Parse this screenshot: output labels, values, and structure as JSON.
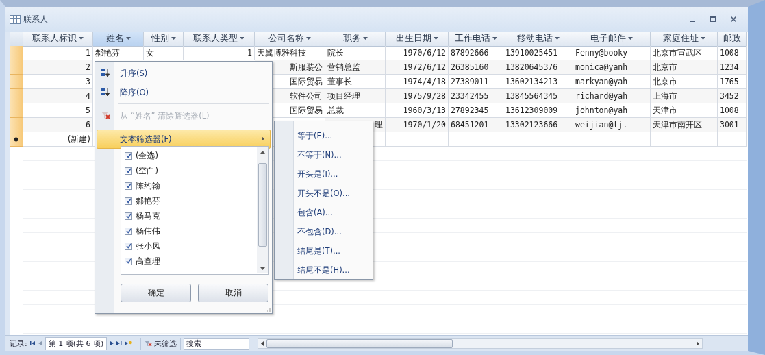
{
  "window": {
    "title": "联系人"
  },
  "table": {
    "columns": [
      {
        "label": "联系人标识",
        "kind": "number",
        "selected": false,
        "dropdown": true
      },
      {
        "label": "姓名",
        "kind": "text",
        "selected": true,
        "dropdown": true
      },
      {
        "label": "性别",
        "kind": "text",
        "selected": false,
        "dropdown": true
      },
      {
        "label": "联系人类型",
        "kind": "number",
        "selected": false,
        "dropdown": true
      },
      {
        "label": "公司名称",
        "kind": "text",
        "selected": false,
        "dropdown": true
      },
      {
        "label": "职务",
        "kind": "text",
        "selected": false,
        "dropdown": true
      },
      {
        "label": "出生日期",
        "kind": "number",
        "selected": false,
        "dropdown": true
      },
      {
        "label": "工作电话",
        "kind": "text",
        "selected": false,
        "dropdown": true
      },
      {
        "label": "移动电话",
        "kind": "text",
        "selected": false,
        "dropdown": true
      },
      {
        "label": "电子邮件",
        "kind": "text",
        "selected": false,
        "dropdown": true
      },
      {
        "label": "家庭住址",
        "kind": "text",
        "selected": false,
        "dropdown": true
      },
      {
        "label": "邮政",
        "kind": "text",
        "selected": false,
        "dropdown": false
      }
    ],
    "rows": [
      [
        "1",
        "郝艳芬",
        "女",
        "1",
        "天翼博雅科技",
        "院长",
        "1970/6/12",
        "87892666",
        "13910025451",
        "Fenny@booky",
        "北京市宣武区",
        "1008"
      ],
      [
        "2",
        null,
        null,
        null,
        "斯服装公",
        "营销总监",
        "1972/6/12",
        "26385160",
        "13820645376",
        "monica@yanh",
        "北京市",
        "1234"
      ],
      [
        "3",
        null,
        null,
        null,
        "国际贸易",
        "董事长",
        "1974/4/18",
        "27389011",
        "13602134213",
        "markyan@yah",
        "北京市",
        "1765"
      ],
      [
        "4",
        null,
        null,
        null,
        "软件公司",
        "项目经理",
        "1975/9/28",
        "23342455",
        "13845564345",
        "richard@yah",
        "上海市",
        "3452"
      ],
      [
        "5",
        null,
        null,
        null,
        "国际贸易",
        "总裁",
        "1960/3/13",
        "27892345",
        "13612309009",
        "johnton@yah",
        "天津市",
        "1008"
      ],
      [
        "6",
        null,
        null,
        null,
        null,
        "理",
        "1970/1/20",
        "68451201",
        "13302123666",
        "weijian@tj.",
        "天津市南开区",
        "3001"
      ]
    ],
    "new_row": {
      "label": "(新建)"
    }
  },
  "filter_menu": {
    "items": [
      {
        "kind": "sort-asc",
        "label": "升序(S)",
        "disabled": false,
        "selected": false
      },
      {
        "kind": "sort-desc",
        "label": "降序(O)",
        "disabled": false,
        "selected": false
      },
      {
        "kind": "clear",
        "label": "从 “姓名” 清除筛选器(L)",
        "disabled": true,
        "selected": false
      },
      {
        "kind": "submenu",
        "label": "文本筛选器(F)",
        "disabled": false,
        "selected": true
      }
    ],
    "values": [
      {
        "label": "(全选)",
        "checked": true
      },
      {
        "label": "(空白)",
        "checked": true
      },
      {
        "label": "陈约翰",
        "checked": true
      },
      {
        "label": "郝艳芬",
        "checked": true
      },
      {
        "label": "杨马克",
        "checked": true
      },
      {
        "label": "杨伟伟",
        "checked": true
      },
      {
        "label": "张小凤",
        "checked": true
      },
      {
        "label": "高查理",
        "checked": true
      }
    ],
    "buttons": [
      "确定",
      "取消"
    ],
    "submenu": [
      "等于(E)...",
      "不等于(N)...",
      "开头是(I)...",
      "开头不是(O)...",
      "包含(A)...",
      "不包含(D)...",
      "结尾是(T)...",
      "结尾不是(H)..."
    ]
  },
  "navigator": {
    "label": "记录:",
    "position": "第 1 项(共 6 项)",
    "filter": "未筛选",
    "search_placeholder": "搜索"
  }
}
